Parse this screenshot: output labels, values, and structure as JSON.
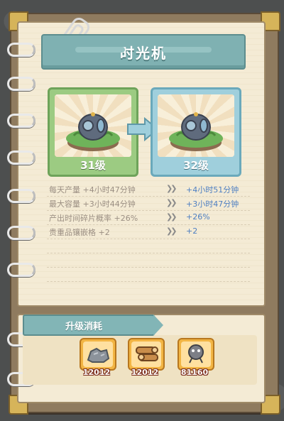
{
  "title": "时光机",
  "current_level": "31级",
  "next_level": "32级",
  "stats": [
    {
      "name": "每天产量",
      "current": "+4小时47分钟",
      "next": "+4小时51分钟"
    },
    {
      "name": "最大容量",
      "current": "+3小时44分钟",
      "next": "+3小时47分钟"
    },
    {
      "name": "产出时间碎片概率",
      "current": "+26%",
      "next": "+26%"
    },
    {
      "name": "贵重品镶嵌格",
      "current": "+2",
      "next": "+2"
    }
  ],
  "upgrade_cost": {
    "title": "升级消耗",
    "items": [
      {
        "icon": "stone-icon",
        "amount": "12012"
      },
      {
        "icon": "wood-icon",
        "amount": "12012"
      },
      {
        "icon": "gear-icon",
        "amount": "81160"
      }
    ]
  },
  "colors": {
    "title_bar": "#7fb1b2",
    "current_card": "#9ccb82",
    "next_card": "#9fcfdc",
    "upgrade_value": "#4e7fc2"
  }
}
